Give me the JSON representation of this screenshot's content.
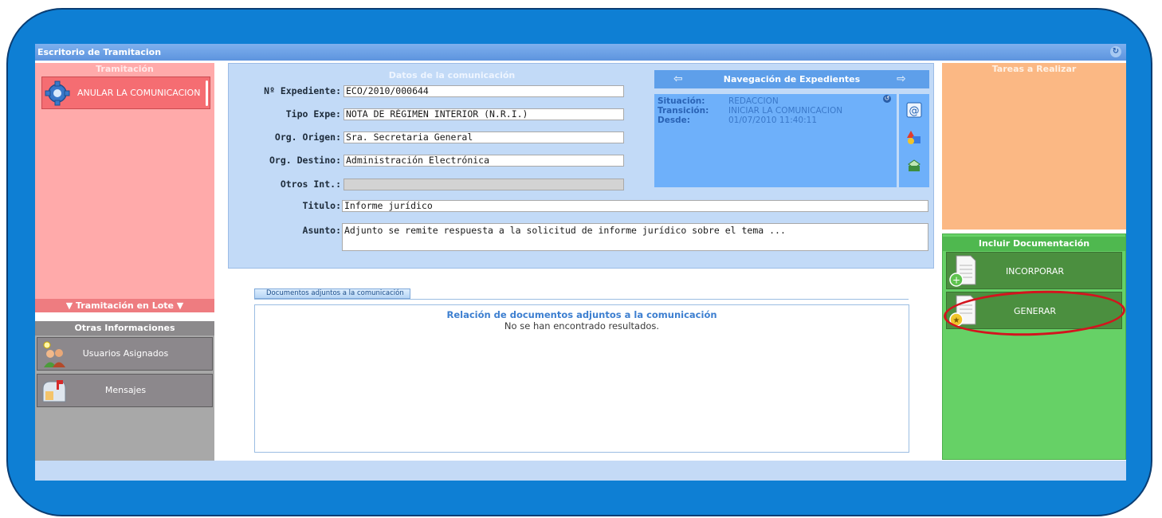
{
  "window": {
    "title": "Escritorio de Tramitacion"
  },
  "tramitacion": {
    "title": "Tramitación",
    "action_label": "ANULAR LA COMUNICACION",
    "lote_label": "▼ Tramitación en Lote ▼"
  },
  "otras": {
    "title": "Otras Informaciones",
    "usuarios_label": "Usuarios Asignados",
    "mensajes_label": "Mensajes"
  },
  "datos": {
    "title": "Datos de la comunicación",
    "expediente_label": "Nº Expediente:",
    "expediente_value": "ECO/2010/000644",
    "tipo_label": "Tipo Expe:",
    "tipo_value": "NOTA DE RÉGIMEN INTERIOR (N.R.I.)",
    "origen_label": "Org. Origen:",
    "origen_value": "Sra. Secretaria General",
    "destino_label": "Org. Destino:",
    "destino_value": "Administración Electrónica",
    "otros_label": "Otros Int.:",
    "otros_value": "",
    "titulo_label": "Titulo:",
    "titulo_value": "Informe jurídico",
    "asunto_label": "Asunto:",
    "asunto_value": "Adjunto se remite respuesta a la solicitud de informe jurídico sobre el tema ..."
  },
  "navegacion": {
    "title": "Navegación de Expedientes",
    "situacion_label": "Situación:",
    "situacion_value": "REDACCION",
    "transicion_label": "Transición:",
    "transicion_value": "INICIAR LA COMUNICACION",
    "desde_label": "Desde:",
    "desde_value": "01/07/2010 11:40:11"
  },
  "documentos": {
    "tab_label": "Documentos adjuntos a la comunicación",
    "heading": "Relación de documentos adjuntos a la comunicación",
    "empty": "No se han encontrado resultados."
  },
  "tareas": {
    "title": "Tareas a Realizar"
  },
  "incluir": {
    "title": "Incluir Documentación",
    "incorporar_label": "INCORPORAR",
    "generar_label": "GENERAR"
  },
  "icons": [
    "gear-icon",
    "users-icon",
    "mailbox-icon",
    "arrow-left-icon",
    "arrow-right-icon",
    "refresh-icon",
    "email-icon",
    "shapes-icon",
    "print-icon",
    "document-add-icon",
    "document-generate-icon"
  ],
  "colors": {
    "frame": "#0e7fd4",
    "tramitacion": "#ffaaaa",
    "tareas": "#fbb884",
    "incluir": "#66d166",
    "highlight": "#d3141e"
  }
}
